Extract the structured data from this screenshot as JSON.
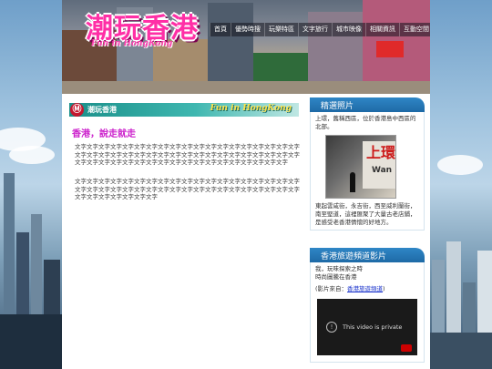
{
  "site": {
    "logo_text": "潮玩香港",
    "logo_tagline": "Fun in HongKong"
  },
  "nav": {
    "items": [
      "首頁",
      "優勢時搜",
      "玩樂特區",
      "文字旅行",
      "城市映像",
      "相關資訊",
      "互動空間"
    ]
  },
  "content": {
    "bar_icon": "mtr-logo-icon",
    "bar_title": "潮玩香港",
    "bar_logo": "Fun in HongKong",
    "heading": "香港，說走就走",
    "paragraph_1": "文字文字文字文字文字文字文字文字文字文字文字文字文字文字文字文字文字文字文字文字文字文字文字文字文字文字文字文字文字文字文字文字文字文字文字文字文字文字文字文字文字文字文字文字文字文字文字文字文字文字文字文字文字文字文字文字",
    "paragraph_2": "文字文字文字文字文字文字文字文字文字文字文字文字文字文字文字文字文字文字文字文字文字文字文字文字文字文字文字文字文字文字文字文字文字文字文字文字文字文字文字文字文字文字文字文字文字"
  },
  "sidebar": {
    "photos": {
      "title": "精選照片",
      "caption_top": "上環，舊稱西區，位於香港島中西區的北部。",
      "photo_sign_text": "上環",
      "photo_sign_text2": "Wan",
      "caption_bottom": "東起雲咸街，永吉街，西至威利蘭街，南至堅道，這裡匯聚了大量古老店鋪，是感受老香港情懷的好地方。"
    },
    "video": {
      "title": "香港旅遊頻道影片",
      "line_1": "我，玩味探索之時",
      "line_2": "時尚圖騰在香港",
      "source_prefix": "(影片來自：",
      "source_link": "香港旅遊頻道",
      "source_suffix": ")",
      "player_message": "This video is private"
    }
  },
  "colors": {
    "heading_magenta": "#cc22cc",
    "panel_blue": "#1e6aa6",
    "teal_bar": "#1a8f89"
  }
}
